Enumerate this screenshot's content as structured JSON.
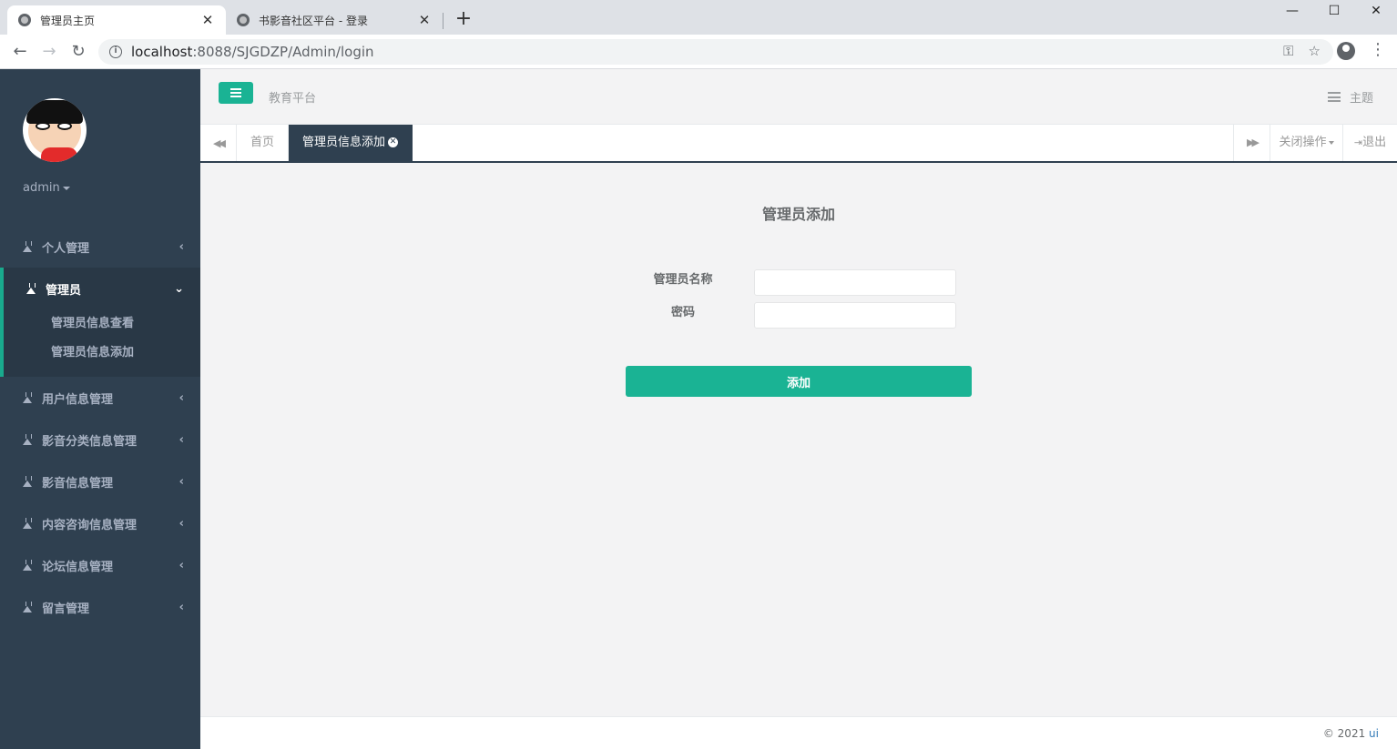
{
  "browser": {
    "tabs": [
      {
        "title": "管理员主页",
        "active": true
      },
      {
        "title": "书影音社区平台 - 登录",
        "active": false
      }
    ],
    "url_host": "localhost",
    "url_rest": ":8088/SJGDZP/Admin/login"
  },
  "sidebar": {
    "username": "admin",
    "menu": [
      {
        "label": "个人管理"
      },
      {
        "label": "管理员",
        "expanded": true,
        "children": [
          {
            "label": "管理员信息查看"
          },
          {
            "label": "管理员信息添加"
          }
        ]
      },
      {
        "label": "用户信息管理"
      },
      {
        "label": "影音分类信息管理"
      },
      {
        "label": "影音信息管理"
      },
      {
        "label": "内容咨询信息管理"
      },
      {
        "label": "论坛信息管理"
      },
      {
        "label": "留言管理"
      }
    ]
  },
  "header": {
    "brand": "教育平台",
    "theme_label": "主题"
  },
  "tabbar": {
    "home": "首页",
    "current": "管理员信息添加",
    "close_ops": "关闭操作",
    "logout": "退出"
  },
  "form": {
    "title": "管理员添加",
    "name_label": "管理员名称",
    "name_value": "",
    "password_label": "密码",
    "password_value": "",
    "submit_label": "添加"
  },
  "footer": {
    "copyright": "© 2021",
    "link": "ui"
  },
  "colors": {
    "sidebar_bg": "#2f4050",
    "accent": "#1ab394"
  }
}
